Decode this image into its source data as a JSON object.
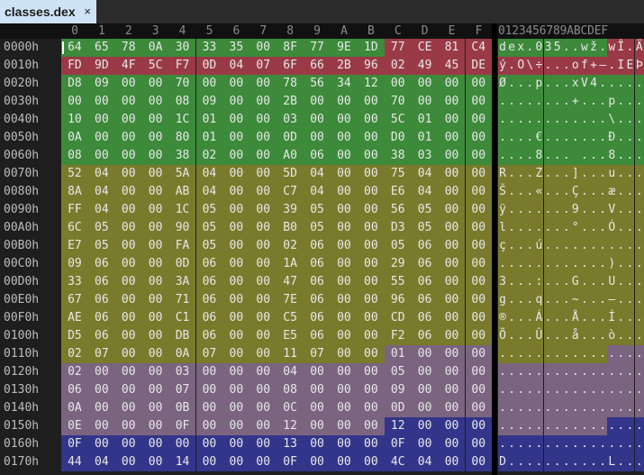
{
  "tab": {
    "title": "classes.dex",
    "close": "×"
  },
  "header": {
    "hex_columns": [
      "0",
      "1",
      "2",
      "3",
      "4",
      "5",
      "6",
      "7",
      "8",
      "9",
      "A",
      "B",
      "C",
      "D",
      "E",
      "F"
    ],
    "ascii_header": "0123456789ABCDEF"
  },
  "colors": {
    "green": "#3c8a3a",
    "red": "#9a3a47",
    "olive": "#7a7a2c",
    "mauve": "#7a6480",
    "blue": "#33358a"
  },
  "rows": [
    {
      "offset": "0000h",
      "bytes": [
        "64",
        "65",
        "78",
        "0A",
        "30",
        "33",
        "35",
        "00",
        "8F",
        "77",
        "9E",
        "1D",
        "77",
        "CE",
        "81",
        "C4"
      ],
      "colors": [
        "green",
        "green",
        "green",
        "green",
        "green",
        "green",
        "green",
        "green",
        "green",
        "green",
        "green",
        "green",
        "red",
        "red",
        "red",
        "red"
      ],
      "ascii": "dex.035..wž.wÎ.Ä"
    },
    {
      "offset": "0010h",
      "bytes": [
        "FD",
        "9D",
        "4F",
        "5C",
        "F7",
        "0D",
        "04",
        "07",
        "6F",
        "66",
        "2B",
        "96",
        "02",
        "49",
        "45",
        "DE"
      ],
      "colors": [
        "red",
        "red",
        "red",
        "red",
        "red",
        "red",
        "red",
        "red",
        "red",
        "red",
        "red",
        "red",
        "red",
        "red",
        "red",
        "red"
      ],
      "ascii": "ý.O\\÷...of+–.IEÞ"
    },
    {
      "offset": "0020h",
      "bytes": [
        "D8",
        "09",
        "00",
        "00",
        "70",
        "00",
        "00",
        "00",
        "78",
        "56",
        "34",
        "12",
        "00",
        "00",
        "00",
        "00"
      ],
      "colors": [
        "green",
        "green",
        "green",
        "green",
        "green",
        "green",
        "green",
        "green",
        "green",
        "green",
        "green",
        "green",
        "green",
        "green",
        "green",
        "green"
      ],
      "ascii": "Ø...p...xV4....."
    },
    {
      "offset": "0030h",
      "bytes": [
        "00",
        "00",
        "00",
        "00",
        "08",
        "09",
        "00",
        "00",
        "2B",
        "00",
        "00",
        "00",
        "70",
        "00",
        "00",
        "00"
      ],
      "colors": [
        "green",
        "green",
        "green",
        "green",
        "green",
        "green",
        "green",
        "green",
        "green",
        "green",
        "green",
        "green",
        "green",
        "green",
        "green",
        "green"
      ],
      "ascii": "........+...p..."
    },
    {
      "offset": "0040h",
      "bytes": [
        "10",
        "00",
        "00",
        "00",
        "1C",
        "01",
        "00",
        "00",
        "03",
        "00",
        "00",
        "00",
        "5C",
        "01",
        "00",
        "00"
      ],
      "colors": [
        "green",
        "green",
        "green",
        "green",
        "green",
        "green",
        "green",
        "green",
        "green",
        "green",
        "green",
        "green",
        "green",
        "green",
        "green",
        "green"
      ],
      "ascii": "............\\..."
    },
    {
      "offset": "0050h",
      "bytes": [
        "0A",
        "00",
        "00",
        "00",
        "80",
        "01",
        "00",
        "00",
        "0D",
        "00",
        "00",
        "00",
        "D0",
        "01",
        "00",
        "00"
      ],
      "colors": [
        "green",
        "green",
        "green",
        "green",
        "green",
        "green",
        "green",
        "green",
        "green",
        "green",
        "green",
        "green",
        "green",
        "green",
        "green",
        "green"
      ],
      "ascii": "....€.......Ð..."
    },
    {
      "offset": "0060h",
      "bytes": [
        "08",
        "00",
        "00",
        "00",
        "38",
        "02",
        "00",
        "00",
        "A0",
        "06",
        "00",
        "00",
        "38",
        "03",
        "00",
        "00"
      ],
      "colors": [
        "green",
        "green",
        "green",
        "green",
        "green",
        "green",
        "green",
        "green",
        "green",
        "green",
        "green",
        "green",
        "green",
        "green",
        "green",
        "green"
      ],
      "ascii": "....8... ...8..."
    },
    {
      "offset": "0070h",
      "bytes": [
        "52",
        "04",
        "00",
        "00",
        "5A",
        "04",
        "00",
        "00",
        "5D",
        "04",
        "00",
        "00",
        "75",
        "04",
        "00",
        "00"
      ],
      "colors": [
        "olive",
        "olive",
        "olive",
        "olive",
        "olive",
        "olive",
        "olive",
        "olive",
        "olive",
        "olive",
        "olive",
        "olive",
        "olive",
        "olive",
        "olive",
        "olive"
      ],
      "ascii": "R...Z...]...u..."
    },
    {
      "offset": "0080h",
      "bytes": [
        "8A",
        "04",
        "00",
        "00",
        "AB",
        "04",
        "00",
        "00",
        "C7",
        "04",
        "00",
        "00",
        "E6",
        "04",
        "00",
        "00"
      ],
      "colors": [
        "olive",
        "olive",
        "olive",
        "olive",
        "olive",
        "olive",
        "olive",
        "olive",
        "olive",
        "olive",
        "olive",
        "olive",
        "olive",
        "olive",
        "olive",
        "olive"
      ],
      "ascii": "Š...«...Ç...æ..."
    },
    {
      "offset": "0090h",
      "bytes": [
        "FF",
        "04",
        "00",
        "00",
        "1C",
        "05",
        "00",
        "00",
        "39",
        "05",
        "00",
        "00",
        "56",
        "05",
        "00",
        "00"
      ],
      "colors": [
        "olive",
        "olive",
        "olive",
        "olive",
        "olive",
        "olive",
        "olive",
        "olive",
        "olive",
        "olive",
        "olive",
        "olive",
        "olive",
        "olive",
        "olive",
        "olive"
      ],
      "ascii": "ÿ.......9...V..."
    },
    {
      "offset": "00A0h",
      "bytes": [
        "6C",
        "05",
        "00",
        "00",
        "90",
        "05",
        "00",
        "00",
        "B0",
        "05",
        "00",
        "00",
        "D3",
        "05",
        "00",
        "00"
      ],
      "colors": [
        "olive",
        "olive",
        "olive",
        "olive",
        "olive",
        "olive",
        "olive",
        "olive",
        "olive",
        "olive",
        "olive",
        "olive",
        "olive",
        "olive",
        "olive",
        "olive"
      ],
      "ascii": "l.......°...Ó..."
    },
    {
      "offset": "00B0h",
      "bytes": [
        "E7",
        "05",
        "00",
        "00",
        "FA",
        "05",
        "00",
        "00",
        "02",
        "06",
        "00",
        "00",
        "05",
        "06",
        "00",
        "00"
      ],
      "colors": [
        "olive",
        "olive",
        "olive",
        "olive",
        "olive",
        "olive",
        "olive",
        "olive",
        "olive",
        "olive",
        "olive",
        "olive",
        "olive",
        "olive",
        "olive",
        "olive"
      ],
      "ascii": "ç...ú..........."
    },
    {
      "offset": "00C0h",
      "bytes": [
        "09",
        "06",
        "00",
        "00",
        "0D",
        "06",
        "00",
        "00",
        "1A",
        "06",
        "00",
        "00",
        "29",
        "06",
        "00",
        "00"
      ],
      "colors": [
        "olive",
        "olive",
        "olive",
        "olive",
        "olive",
        "olive",
        "olive",
        "olive",
        "olive",
        "olive",
        "olive",
        "olive",
        "olive",
        "olive",
        "olive",
        "olive"
      ],
      "ascii": "............)..."
    },
    {
      "offset": "00D0h",
      "bytes": [
        "33",
        "06",
        "00",
        "00",
        "3A",
        "06",
        "00",
        "00",
        "47",
        "06",
        "00",
        "00",
        "55",
        "06",
        "00",
        "00"
      ],
      "colors": [
        "olive",
        "olive",
        "olive",
        "olive",
        "olive",
        "olive",
        "olive",
        "olive",
        "olive",
        "olive",
        "olive",
        "olive",
        "olive",
        "olive",
        "olive",
        "olive"
      ],
      "ascii": "3...:...G...U..."
    },
    {
      "offset": "00E0h",
      "bytes": [
        "67",
        "06",
        "00",
        "00",
        "71",
        "06",
        "00",
        "00",
        "7E",
        "06",
        "00",
        "00",
        "96",
        "06",
        "00",
        "00"
      ],
      "colors": [
        "olive",
        "olive",
        "olive",
        "olive",
        "olive",
        "olive",
        "olive",
        "olive",
        "olive",
        "olive",
        "olive",
        "olive",
        "olive",
        "olive",
        "olive",
        "olive"
      ],
      "ascii": "g...q...~...–..."
    },
    {
      "offset": "00F0h",
      "bytes": [
        "AE",
        "06",
        "00",
        "00",
        "C1",
        "06",
        "00",
        "00",
        "C5",
        "06",
        "00",
        "00",
        "CD",
        "06",
        "00",
        "00"
      ],
      "colors": [
        "olive",
        "olive",
        "olive",
        "olive",
        "olive",
        "olive",
        "olive",
        "olive",
        "olive",
        "olive",
        "olive",
        "olive",
        "olive",
        "olive",
        "olive",
        "olive"
      ],
      "ascii": "®...Á...Å...Í..."
    },
    {
      "offset": "0100h",
      "bytes": [
        "D5",
        "06",
        "00",
        "00",
        "DB",
        "06",
        "00",
        "00",
        "E5",
        "06",
        "00",
        "00",
        "F2",
        "06",
        "00",
        "00"
      ],
      "colors": [
        "olive",
        "olive",
        "olive",
        "olive",
        "olive",
        "olive",
        "olive",
        "olive",
        "olive",
        "olive",
        "olive",
        "olive",
        "olive",
        "olive",
        "olive",
        "olive"
      ],
      "ascii": "Õ...Û...å...ò..."
    },
    {
      "offset": "0110h",
      "bytes": [
        "02",
        "07",
        "00",
        "00",
        "0A",
        "07",
        "00",
        "00",
        "11",
        "07",
        "00",
        "00",
        "01",
        "00",
        "00",
        "00"
      ],
      "colors": [
        "olive",
        "olive",
        "olive",
        "olive",
        "olive",
        "olive",
        "olive",
        "olive",
        "olive",
        "olive",
        "olive",
        "olive",
        "mauve",
        "mauve",
        "mauve",
        "mauve"
      ],
      "ascii": "................"
    },
    {
      "offset": "0120h",
      "bytes": [
        "02",
        "00",
        "00",
        "00",
        "03",
        "00",
        "00",
        "00",
        "04",
        "00",
        "00",
        "00",
        "05",
        "00",
        "00",
        "00"
      ],
      "colors": [
        "mauve",
        "mauve",
        "mauve",
        "mauve",
        "mauve",
        "mauve",
        "mauve",
        "mauve",
        "mauve",
        "mauve",
        "mauve",
        "mauve",
        "mauve",
        "mauve",
        "mauve",
        "mauve"
      ],
      "ascii": "................"
    },
    {
      "offset": "0130h",
      "bytes": [
        "06",
        "00",
        "00",
        "00",
        "07",
        "00",
        "00",
        "00",
        "08",
        "00",
        "00",
        "00",
        "09",
        "00",
        "00",
        "00"
      ],
      "colors": [
        "mauve",
        "mauve",
        "mauve",
        "mauve",
        "mauve",
        "mauve",
        "mauve",
        "mauve",
        "mauve",
        "mauve",
        "mauve",
        "mauve",
        "mauve",
        "mauve",
        "mauve",
        "mauve"
      ],
      "ascii": "................"
    },
    {
      "offset": "0140h",
      "bytes": [
        "0A",
        "00",
        "00",
        "00",
        "0B",
        "00",
        "00",
        "00",
        "0C",
        "00",
        "00",
        "00",
        "0D",
        "00",
        "00",
        "00"
      ],
      "colors": [
        "mauve",
        "mauve",
        "mauve",
        "mauve",
        "mauve",
        "mauve",
        "mauve",
        "mauve",
        "mauve",
        "mauve",
        "mauve",
        "mauve",
        "mauve",
        "mauve",
        "mauve",
        "mauve"
      ],
      "ascii": "................"
    },
    {
      "offset": "0150h",
      "bytes": [
        "0E",
        "00",
        "00",
        "00",
        "0F",
        "00",
        "00",
        "00",
        "12",
        "00",
        "00",
        "00",
        "12",
        "00",
        "00",
        "00"
      ],
      "colors": [
        "mauve",
        "mauve",
        "mauve",
        "mauve",
        "mauve",
        "mauve",
        "mauve",
        "mauve",
        "mauve",
        "mauve",
        "mauve",
        "mauve",
        "blue",
        "blue",
        "blue",
        "blue"
      ],
      "ascii": "................"
    },
    {
      "offset": "0160h",
      "bytes": [
        "0F",
        "00",
        "00",
        "00",
        "00",
        "00",
        "00",
        "00",
        "13",
        "00",
        "00",
        "00",
        "0F",
        "00",
        "00",
        "00"
      ],
      "colors": [
        "blue",
        "blue",
        "blue",
        "blue",
        "blue",
        "blue",
        "blue",
        "blue",
        "blue",
        "blue",
        "blue",
        "blue",
        "blue",
        "blue",
        "blue",
        "blue"
      ],
      "ascii": "................"
    },
    {
      "offset": "0170h",
      "bytes": [
        "44",
        "04",
        "00",
        "00",
        "14",
        "00",
        "00",
        "00",
        "0F",
        "00",
        "00",
        "00",
        "4C",
        "04",
        "00",
        "00"
      ],
      "colors": [
        "blue",
        "blue",
        "blue",
        "blue",
        "blue",
        "blue",
        "blue",
        "blue",
        "blue",
        "blue",
        "blue",
        "blue",
        "blue",
        "blue",
        "blue",
        "blue"
      ],
      "ascii": "D...........L..."
    }
  ]
}
